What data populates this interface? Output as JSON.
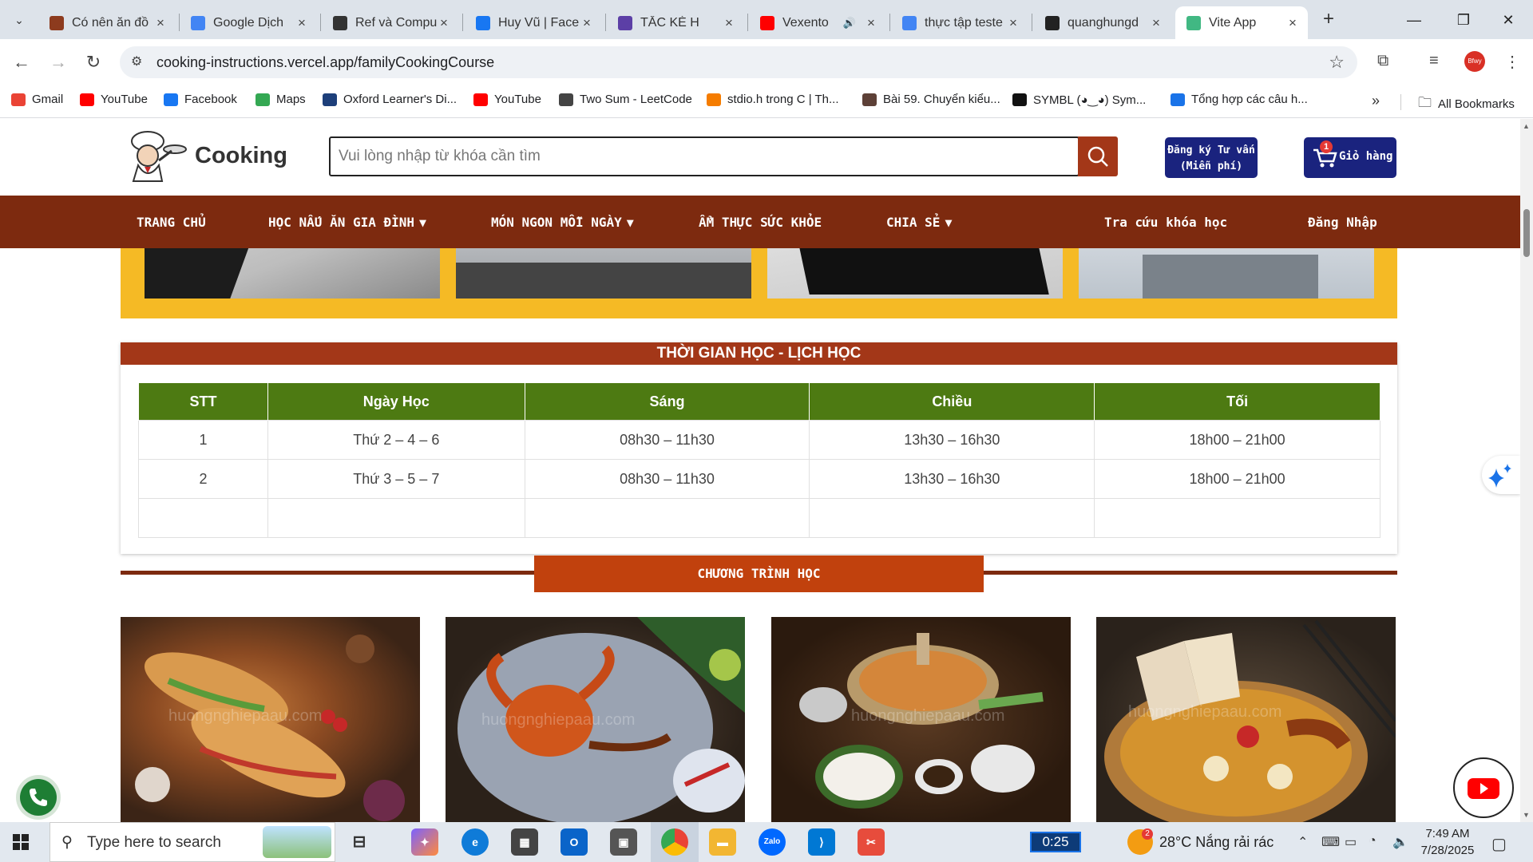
{
  "browser": {
    "tabs": [
      {
        "title": "Có nên ăn đồ",
        "icon": "letter-m-icon",
        "color": "#8d3b1e"
      },
      {
        "title": "Google Dịch",
        "icon": "google-translate-icon",
        "color": "#4285f4"
      },
      {
        "title": "Ref và Compu",
        "icon": "openai-icon",
        "color": "#333333"
      },
      {
        "title": "Huy Vũ | Face",
        "icon": "facebook-icon",
        "color": "#1877f2"
      },
      {
        "title": "TẮC KÈ H",
        "icon": "gecko-icon",
        "color": "#5c3fa6"
      },
      {
        "title": "Vexento",
        "icon": "youtube-icon",
        "color": "#ff0000"
      },
      {
        "title": "thực tập teste",
        "icon": "google-icon",
        "color": "#4285f4"
      },
      {
        "title": "quanghungd",
        "icon": "github-icon",
        "color": "#222222"
      },
      {
        "title": "Vite App",
        "icon": "vue-icon",
        "color": "#41b883"
      }
    ],
    "url": "cooking-instructions.vercel.app/familyCookingCourse",
    "bookmarks": [
      {
        "label": "Gmail",
        "color": "#ea4335"
      },
      {
        "label": "YouTube",
        "color": "#ff0000"
      },
      {
        "label": "Facebook",
        "color": "#1877f2"
      },
      {
        "label": "Maps",
        "color": "#34a853"
      },
      {
        "label": "Oxford Learner's Di...",
        "color": "#1d3f7a"
      },
      {
        "label": "YouTube",
        "color": "#ff0000"
      },
      {
        "label": "Two Sum - LeetCode",
        "color": "#444444"
      },
      {
        "label": "stdio.h trong C | Th...",
        "color": "#f57c00"
      },
      {
        "label": "Bài 59. Chuyển kiểu...",
        "color": "#5d4037"
      },
      {
        "label": "SYMBL (◕‿◕) Sym...",
        "color": "#111111"
      },
      {
        "label": "Tổng hợp các câu h...",
        "color": "#1a73e8"
      }
    ],
    "all_bookmarks": "All Bookmarks",
    "profile_text": "Bfwy"
  },
  "site": {
    "logo": "Cooking",
    "search_placeholder": "Vui lòng nhập từ khóa cần tìm",
    "register_line1": "Đăng ký Tư vấn",
    "register_line2": "(Miễn phí)",
    "cart_label": "Giỏ hàng",
    "cart_count": "1",
    "nav": [
      {
        "label": "TRANG CHỦ",
        "caret": ""
      },
      {
        "label": "HỌC NẤU ĂN GIA ĐÌNH",
        "caret": "▼"
      },
      {
        "label": "MÓN NGON MỖI NGÀY",
        "caret": "▼"
      },
      {
        "label": "ẨM THỰC SỨC KHỎE",
        "caret": ""
      },
      {
        "label": "CHIA SẺ",
        "caret": "▼"
      },
      {
        "label": "Tra cứu khóa học",
        "caret": ""
      },
      {
        "label": "Đăng Nhập",
        "caret": ""
      }
    ],
    "brand_color": "#7d2a0f",
    "accent_yellow": "#f5ba25",
    "table_green": "#4d7a12"
  },
  "schedule": {
    "title": "THỜI GIAN HỌC - LỊCH HỌC",
    "headers": [
      "STT",
      "Ngày Học",
      "Sáng",
      "Chiều",
      "Tối"
    ],
    "rows": [
      [
        "1",
        "Thứ 2 – 4 – 6",
        "08h30 – 11h30",
        "13h30 – 16h30",
        "18h00 – 21h00"
      ],
      [
        "2",
        "Thứ 3 – 5 – 7",
        "08h30 – 11h30",
        "13h30 – 16h30",
        "18h00 – 21h00"
      ],
      [
        "",
        "",
        "",
        "",
        ""
      ]
    ]
  },
  "program": {
    "title": "CHƯƠNG TRÌNH HỌC",
    "watermark": "huongnghiepaau.com"
  },
  "taskbar": {
    "search_placeholder": "Type here to search",
    "timer": "0:25",
    "weather": "28°C  Nắng rải rác",
    "time": "7:49 AM",
    "date": "7/28/2025"
  }
}
